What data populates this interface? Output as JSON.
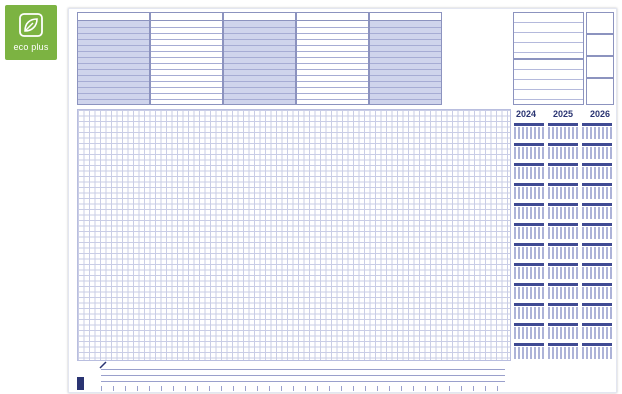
{
  "badge": {
    "label": "eco plus",
    "color": "#7cb342",
    "icon": "leaf-icon"
  },
  "calendar": {
    "years": [
      "2024",
      "2025",
      "2026"
    ],
    "accent": "#3f4a93"
  }
}
